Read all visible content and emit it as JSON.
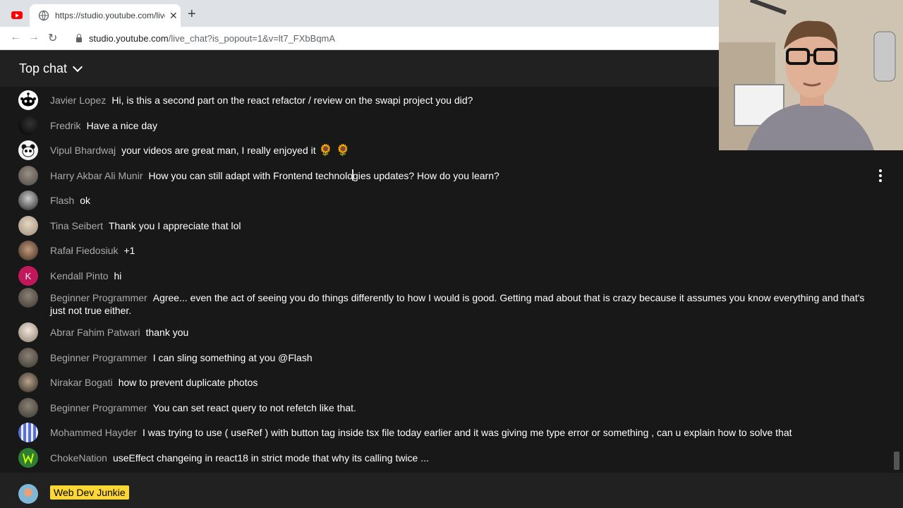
{
  "browser": {
    "tab_title": "https://studio.youtube.com/live_chat?is_popout=1&v=lt7_FXbBqmA",
    "close_label": "✕",
    "new_tab_label": "+",
    "back_label": "←",
    "forward_label": "→",
    "reload_label": "↻",
    "url_host": "studio.youtube.com",
    "url_path": "/live_chat?is_popout=1&v=lt7_FXbBqmA"
  },
  "chat": {
    "mode_label": "Top chat",
    "messages": [
      {
        "author": "Javier Lopez",
        "text": "Hi, is this a second part on the react refactor / review on the swapi project you did?"
      },
      {
        "author": "Fredrik",
        "text": "Have a nice day"
      },
      {
        "author": "Vipul Bhardwaj",
        "text": "your videos are great man, I really enjoyed it",
        "emojis": "🌻 🌻"
      },
      {
        "author": "Harry Akbar Ali Munir",
        "text": "How you can still adapt with Frontend technologies updates? How do you learn?"
      },
      {
        "author": "Flash",
        "text": "ok"
      },
      {
        "author": "Tina Seibert",
        "text": "Thank you I appreciate that lol"
      },
      {
        "author": "Rafał Fiedosiuk",
        "text": "+1"
      },
      {
        "author": "Kendall Pinto",
        "text": "hi",
        "avatar_letter": "K"
      },
      {
        "author": "Beginner Programmer",
        "text": "Agree... even the act of seeing you do things differently to how I would is good. Getting mad about that is crazy because it assumes you know everything and that's just not true either."
      },
      {
        "author": "Abrar Fahim Patwari",
        "text": "thank you"
      },
      {
        "author": "Beginner Programmer",
        "text": "I can sling something at you @Flash"
      },
      {
        "author": "Nirakar Bogati",
        "text": "how to prevent duplicate photos"
      },
      {
        "author": "Beginner Programmer",
        "text": "You can set react query to not refetch like that."
      },
      {
        "author": "Mohammed Hayder",
        "text": "I was trying to use ( useRef ) with button tag inside tsx file today earlier and it was giving me type error or something , can u explain how to solve that"
      },
      {
        "author": "ChokeNation",
        "text": "useEffect changeing in react18 in strict mode that why its calling twice ..."
      }
    ],
    "self_name": "Web Dev Junkie"
  }
}
